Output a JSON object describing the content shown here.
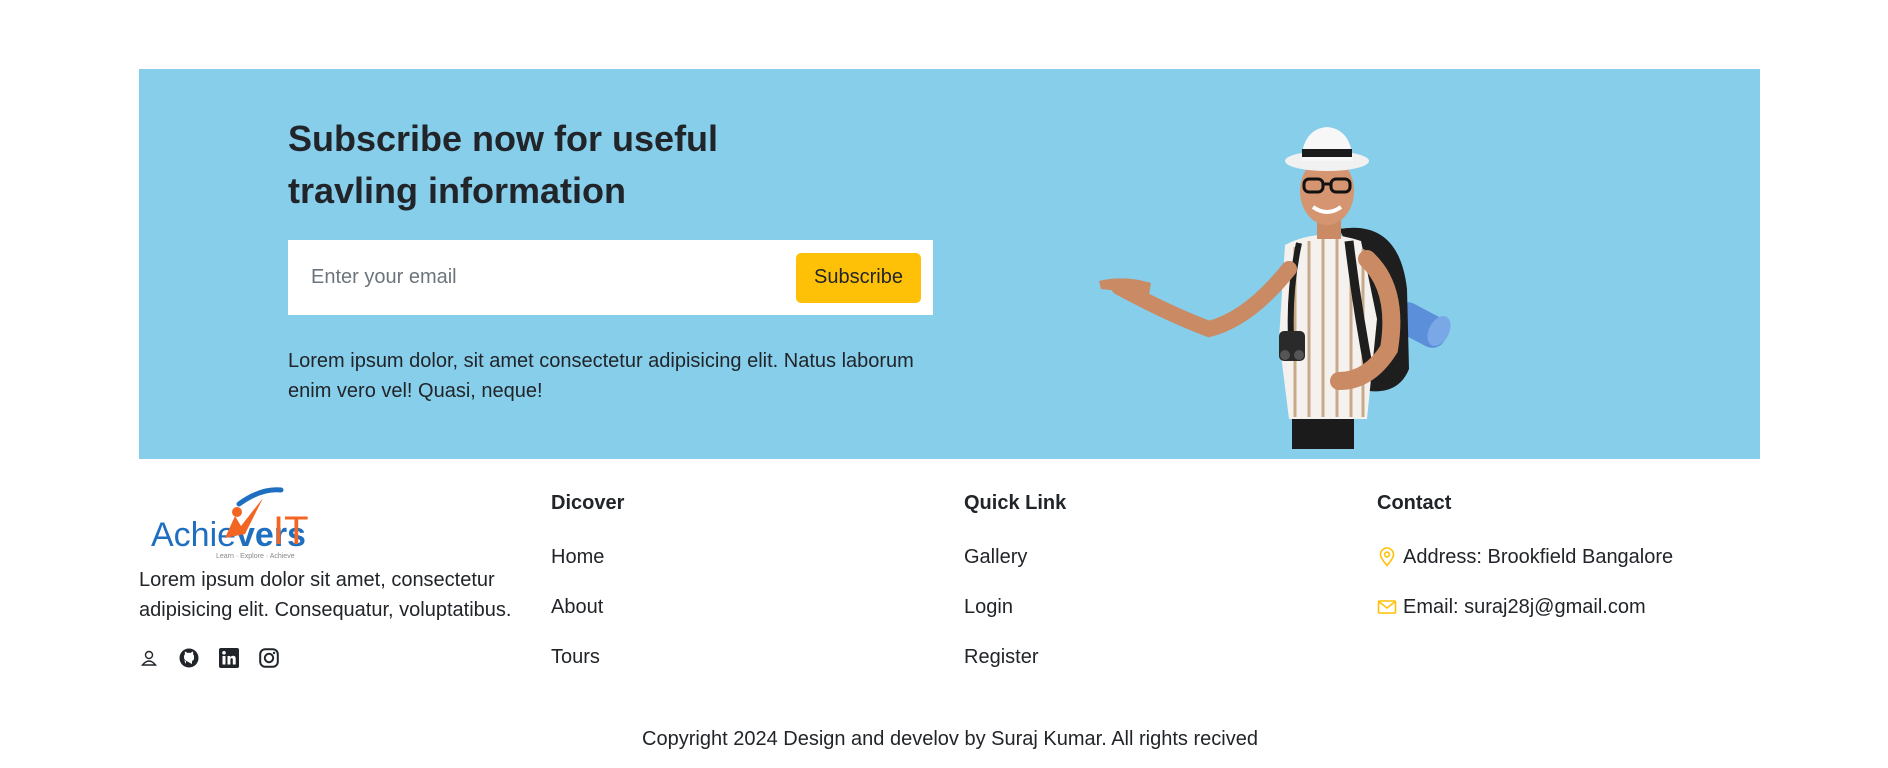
{
  "newsletter": {
    "title_line1": "Subscribe now for useful",
    "title_line2": "travling information",
    "email_placeholder": "Enter your email",
    "subscribe_label": "Subscribe",
    "description": "Lorem ipsum dolor, sit amet consectetur adipisicing elit. Natus laborum enim vero vel! Quasi, neque!",
    "background_color": "#87ceeb",
    "button_color": "#ffc107"
  },
  "footer": {
    "logo": {
      "text_left": "Achie",
      "text_mid": "vers",
      "text_right": "IT",
      "tagline": "Learn · Explore · Achieve"
    },
    "description": "Lorem ipsum dolor sit amet, consectetur adipisicing elit. Consequatur, voluptatibus.",
    "socials": [
      {
        "icon": "user-icon"
      },
      {
        "icon": "github-icon"
      },
      {
        "icon": "linkedin-icon"
      },
      {
        "icon": "instagram-icon"
      }
    ],
    "discover": {
      "heading": "Dicover",
      "links": [
        "Home",
        "About",
        "Tours"
      ]
    },
    "quick_link": {
      "heading": "Quick Link",
      "links": [
        "Gallery",
        "Login",
        "Register"
      ]
    },
    "contact": {
      "heading": "Contact",
      "address": "Address: Brookfield Bangalore",
      "email": "Email: suraj28j@gmail.com",
      "icon_color": "#ffc107"
    },
    "copyright": "Copyright 2024 Design and develov by Suraj Kumar. All rights recived"
  }
}
